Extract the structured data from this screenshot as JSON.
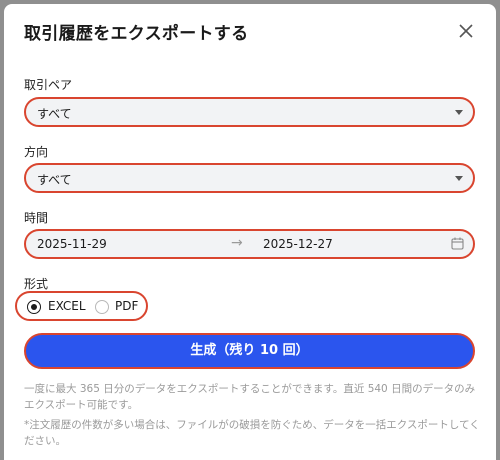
{
  "modal": {
    "title": "取引履歴をエクスポートする",
    "close_icon": "close-icon"
  },
  "pair": {
    "label": "取引ペア",
    "value": "すべて"
  },
  "direction": {
    "label": "方向",
    "value": "すべて"
  },
  "time": {
    "label": "時間",
    "start": "2025-11-29",
    "arrow": "→",
    "end": "2025-12-27",
    "icon": "calendar-icon"
  },
  "format": {
    "label": "形式",
    "options": [
      "EXCEL",
      "PDF"
    ],
    "selected": "EXCEL"
  },
  "generate_label": "生成（残り 10 回）",
  "notes": [
    "一度に最大 365 日分のデータをエクスポートすることができます。直近 540 日間のデータのみエクスポート可能です。",
    "*注文履歴の件数が多い場合は、ファイルがの破損を防ぐため、データを一括エクスポートしてください。"
  ],
  "colors": {
    "primary": "#2b55ee",
    "highlight": "#d9452f",
    "field_bg": "#f2f3f5"
  }
}
